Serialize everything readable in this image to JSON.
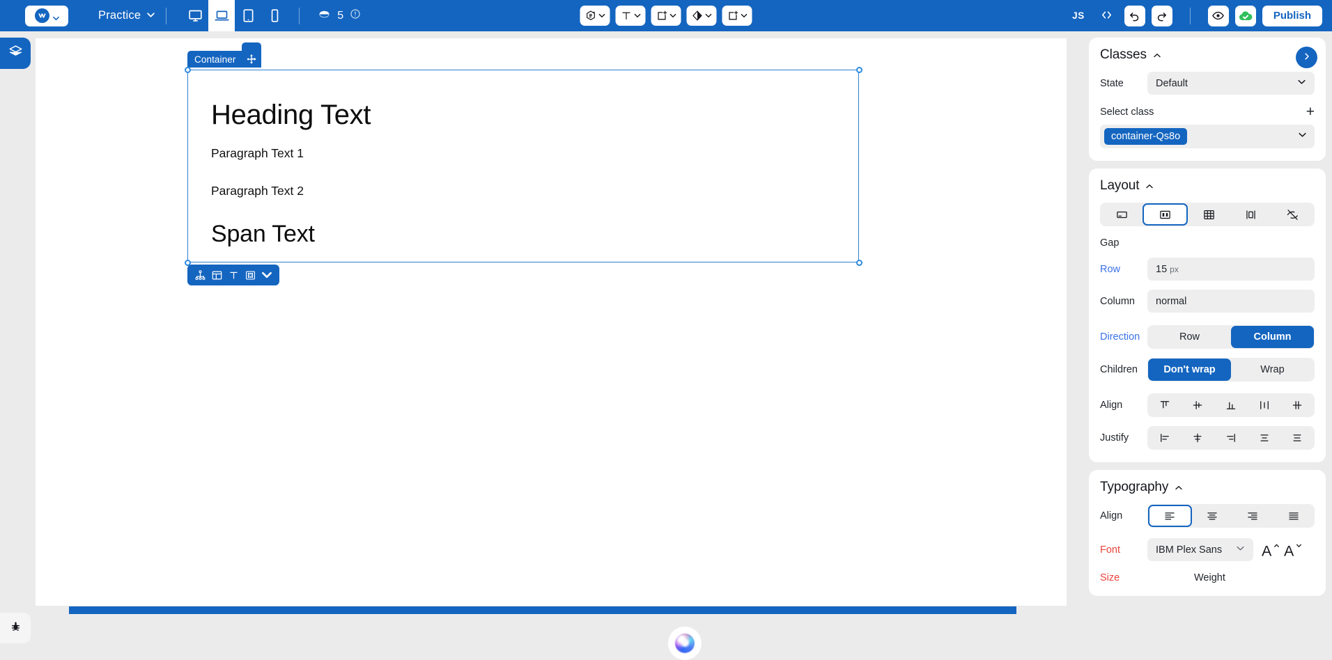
{
  "topbar": {
    "logo_icon": "webflow-logo-icon",
    "logo_caret_icon": "chevron-down-icon",
    "project_name": "Practice",
    "project_caret_icon": "chevron-down-icon",
    "breakpoints": [
      {
        "name": "desktop",
        "icon": "monitor-icon",
        "active": false
      },
      {
        "name": "laptop",
        "icon": "laptop-icon",
        "active": true
      },
      {
        "name": "tablet",
        "icon": "tablet-icon",
        "active": false
      },
      {
        "name": "mobile",
        "icon": "mobile-icon",
        "active": false
      }
    ],
    "pages_icon": "pages-stack-icon",
    "pages_count": "5",
    "info_icon": "info-circle-icon",
    "tools": [
      {
        "name": "components",
        "icon": "component-hex-icon",
        "caret": "chevron-down-icon"
      },
      {
        "name": "text",
        "icon": "text-T-icon",
        "caret": "chevron-down-icon"
      },
      {
        "name": "add-element",
        "icon": "add-block-icon",
        "caret": "chevron-down-icon"
      },
      {
        "name": "style",
        "icon": "contrast-diamond-icon",
        "caret": "chevron-down-icon"
      },
      {
        "name": "add-container",
        "icon": "add-block-icon",
        "caret": "chevron-down-icon"
      }
    ],
    "js_label": "JS",
    "code_icon": "code-brackets-icon",
    "undo_icon": "undo-arrow-icon",
    "redo_icon": "redo-arrow-icon",
    "preview_icon": "eye-icon",
    "sync_icon": "cloud-check-icon",
    "publish_label": "Publish"
  },
  "leftrail": {
    "layers_icon": "layers-stack-icon",
    "bug_icon": "bug-icon"
  },
  "canvas": {
    "selection_tag": "Container",
    "move_icon": "move-arrows-icon",
    "heading": "Heading Text",
    "paragraph1": "Paragraph Text 1",
    "paragraph2": "Paragraph Text 2",
    "span": "Span Text",
    "element_toolbar": [
      {
        "name": "component-tree",
        "icon": "node-tree-icon"
      },
      {
        "name": "layout-grid",
        "icon": "layout-panel-icon"
      },
      {
        "name": "text-format",
        "icon": "text-T-icon"
      },
      {
        "name": "spacing",
        "icon": "spacing-box-icon"
      },
      {
        "name": "more",
        "icon": "chevron-down-icon"
      }
    ],
    "ai_orb_icon": "ai-orb-icon"
  },
  "panel": {
    "classes": {
      "title": "Classes",
      "collapse_icon": "chevron-up-icon",
      "next_icon": "chevron-right-icon",
      "state_label": "State",
      "state_value": "Default",
      "state_caret_icon": "chevron-down-icon",
      "select_class_label": "Select class",
      "add_icon": "plus-icon",
      "class_chip": "container-Qs8o",
      "class_caret_icon": "chevron-down-icon"
    },
    "layout": {
      "title": "Layout",
      "collapse_icon": "chevron-up-icon",
      "display_modes": [
        {
          "name": "block",
          "icon": "block-display-icon",
          "selected": false
        },
        {
          "name": "flex",
          "icon": "flex-display-icon",
          "selected": true
        },
        {
          "name": "grid",
          "icon": "grid-display-icon",
          "selected": false
        },
        {
          "name": "inline-block",
          "icon": "inline-block-display-icon",
          "selected": false
        },
        {
          "name": "none",
          "icon": "eye-off-icon",
          "selected": false
        }
      ],
      "gap_label": "Gap",
      "row_label": "Row",
      "row_value": "15",
      "row_unit": "px",
      "column_label": "Column",
      "column_value": "normal",
      "direction_label": "Direction",
      "direction_options": [
        {
          "label": "Row",
          "selected": false
        },
        {
          "label": "Column",
          "selected": true
        }
      ],
      "children_label": "Children",
      "children_options": [
        {
          "label": "Don't wrap",
          "selected": true
        },
        {
          "label": "Wrap",
          "selected": false
        }
      ],
      "align_label": "Align",
      "align_options": [
        {
          "name": "align-start",
          "icon": "align-flex-start-icon"
        },
        {
          "name": "align-center",
          "icon": "align-flex-center-icon"
        },
        {
          "name": "align-end",
          "icon": "align-flex-end-icon"
        },
        {
          "name": "align-stretch",
          "icon": "align-stretch-icon"
        },
        {
          "name": "align-baseline",
          "icon": "align-baseline-icon"
        }
      ],
      "justify_label": "Justify",
      "justify_options": [
        {
          "name": "justify-start",
          "icon": "justify-start-icon"
        },
        {
          "name": "justify-center",
          "icon": "justify-center-icon"
        },
        {
          "name": "justify-end",
          "icon": "justify-end-icon"
        },
        {
          "name": "justify-space-between",
          "icon": "justify-between-icon"
        },
        {
          "name": "justify-space-around",
          "icon": "justify-around-icon"
        }
      ]
    },
    "typography": {
      "title": "Typography",
      "collapse_icon": "chevron-up-icon",
      "align_label": "Align",
      "align_options": [
        {
          "name": "text-align-left",
          "icon": "text-align-left-icon",
          "selected": true
        },
        {
          "name": "text-align-center",
          "icon": "text-align-center-icon",
          "selected": false
        },
        {
          "name": "text-align-right",
          "icon": "text-align-right-icon",
          "selected": false
        },
        {
          "name": "text-align-justify",
          "icon": "text-align-justify-icon",
          "selected": false
        }
      ],
      "font_label": "Font",
      "font_value": "IBM Plex Sans",
      "font_caret_icon": "chevron-down-icon",
      "font_increase_icon": "font-size-up-icon",
      "font_decrease_icon": "font-size-down-icon",
      "size_label": "Size",
      "weight_label": "Weight"
    }
  },
  "colors": {
    "brand_blue": "#1465c0",
    "accent_blue_text": "#3b72e8",
    "accent_red_text": "#e8453c",
    "panel_bg": "#ebebeb",
    "field_bg": "#eeeeee"
  }
}
